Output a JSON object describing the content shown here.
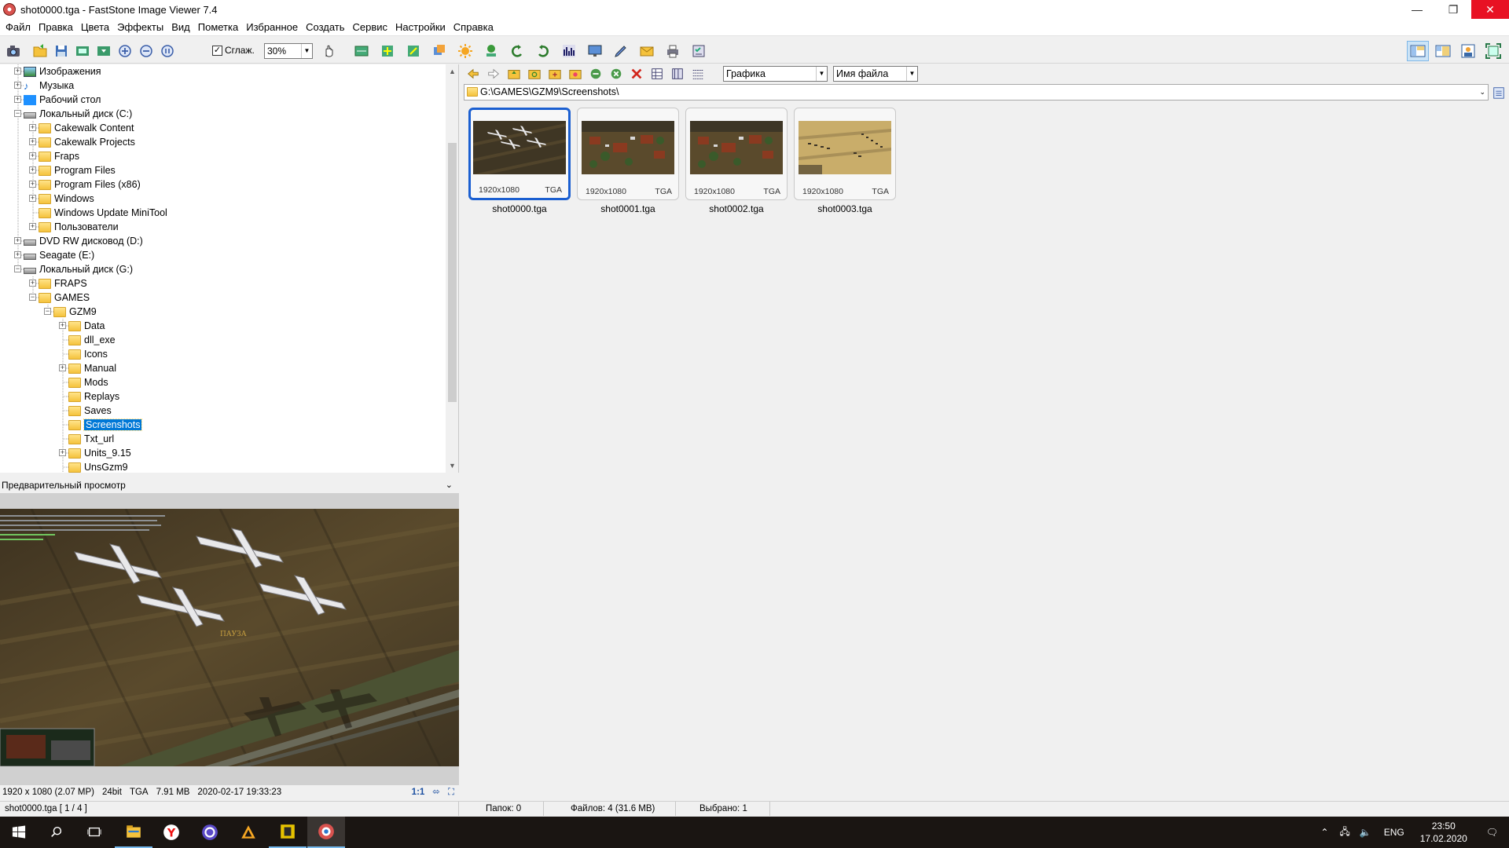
{
  "window": {
    "title": "shot0000.tga  -  FastStone Image Viewer 7.4",
    "minimize": "—",
    "maximize": "❐",
    "close": "✕"
  },
  "menu": [
    "Файл",
    "Правка",
    "Цвета",
    "Эффекты",
    "Вид",
    "Пометка",
    "Избранное",
    "Создать",
    "Сервис",
    "Настройки",
    "Справка"
  ],
  "toolbar": {
    "smooth_label": "Сглаж.",
    "smooth_checked": "✓",
    "zoom_value": "30%"
  },
  "tree": {
    "items": [
      {
        "label": "Изображения",
        "level": 0,
        "expander": "+",
        "icon": "images"
      },
      {
        "label": "Музыка",
        "level": 0,
        "expander": "+",
        "icon": "music"
      },
      {
        "label": "Рабочий стол",
        "level": 0,
        "expander": "+",
        "icon": "desktop"
      },
      {
        "label": "Локальный диск (C:)",
        "level": 0,
        "expander": "−",
        "icon": "drive"
      },
      {
        "label": "Cakewalk Content",
        "level": 1,
        "expander": "+",
        "icon": "folder"
      },
      {
        "label": "Cakewalk Projects",
        "level": 1,
        "expander": "+",
        "icon": "folder"
      },
      {
        "label": "Fraps",
        "level": 1,
        "expander": "+",
        "icon": "folder"
      },
      {
        "label": "Program Files",
        "level": 1,
        "expander": "+",
        "icon": "folder"
      },
      {
        "label": "Program Files (x86)",
        "level": 1,
        "expander": "+",
        "icon": "folder"
      },
      {
        "label": "Windows",
        "level": 1,
        "expander": "+",
        "icon": "folder"
      },
      {
        "label": "Windows Update MiniTool",
        "level": 1,
        "expander": "",
        "icon": "folder"
      },
      {
        "label": "Пользователи",
        "level": 1,
        "expander": "+",
        "icon": "folder"
      },
      {
        "label": "DVD RW дисковод (D:)",
        "level": 0,
        "expander": "+",
        "icon": "dvd"
      },
      {
        "label": "Seagate (E:)",
        "level": 0,
        "expander": "+",
        "icon": "drive"
      },
      {
        "label": "Локальный диск (G:)",
        "level": 0,
        "expander": "−",
        "icon": "drive"
      },
      {
        "label": "FRAPS",
        "level": 1,
        "expander": "+",
        "icon": "folder"
      },
      {
        "label": "GAMES",
        "level": 1,
        "expander": "−",
        "icon": "folder"
      },
      {
        "label": "GZM9",
        "level": 2,
        "expander": "−",
        "icon": "folder"
      },
      {
        "label": "Data",
        "level": 3,
        "expander": "+",
        "icon": "folder"
      },
      {
        "label": "dll_exe",
        "level": 3,
        "expander": "",
        "icon": "folder"
      },
      {
        "label": "Icons",
        "level": 3,
        "expander": "",
        "icon": "folder"
      },
      {
        "label": "Manual",
        "level": 3,
        "expander": "+",
        "icon": "folder"
      },
      {
        "label": "Mods",
        "level": 3,
        "expander": "",
        "icon": "folder"
      },
      {
        "label": "Replays",
        "level": 3,
        "expander": "",
        "icon": "folder"
      },
      {
        "label": "Saves",
        "level": 3,
        "expander": "",
        "icon": "folder"
      },
      {
        "label": "Screenshots",
        "level": 3,
        "expander": "",
        "icon": "folder",
        "selected": true
      },
      {
        "label": "Txt_url",
        "level": 3,
        "expander": "",
        "icon": "folder"
      },
      {
        "label": "Units_9.15",
        "level": 3,
        "expander": "+",
        "icon": "folder"
      },
      {
        "label": "UnsGzm9",
        "level": 3,
        "expander": "",
        "icon": "folder"
      }
    ]
  },
  "preview": {
    "header": "Предварительный просмотр",
    "collapse_icon": "⌄",
    "pause_text": "ПАУЗА",
    "info": {
      "dimensions": "1920 x 1080 (2.07 MP)",
      "bits": "24bit",
      "format": "TGA",
      "size": "7.91 MB",
      "datetime": "2020-02-17 19:33:23",
      "ratio_label": "1:1"
    }
  },
  "browser": {
    "filter_combo": "Графика",
    "sort_combo": "Имя файла",
    "path": "G:\\GAMES\\GZM9\\Screenshots\\",
    "thumbnails": [
      {
        "name": "shot0000.tga",
        "dims": "1920x1080",
        "format": "TGA",
        "selected": true,
        "scene": "planes"
      },
      {
        "name": "shot0001.tga",
        "dims": "1920x1080",
        "format": "TGA",
        "selected": false,
        "scene": "town"
      },
      {
        "name": "shot0002.tga",
        "dims": "1920x1080",
        "format": "TGA",
        "selected": false,
        "scene": "town"
      },
      {
        "name": "shot0003.tga",
        "dims": "1920x1080",
        "format": "TGA",
        "selected": false,
        "scene": "desert"
      }
    ]
  },
  "status": {
    "file": "shot0000.tga [ 1 / 4 ]",
    "folders": "Папок: 0",
    "files": "Файлов: 4 (31.6 MB)",
    "selected": "Выбрано: 1"
  },
  "taskbar": {
    "lang": "ENG",
    "time": "23:50",
    "date": "17.02.2020"
  }
}
